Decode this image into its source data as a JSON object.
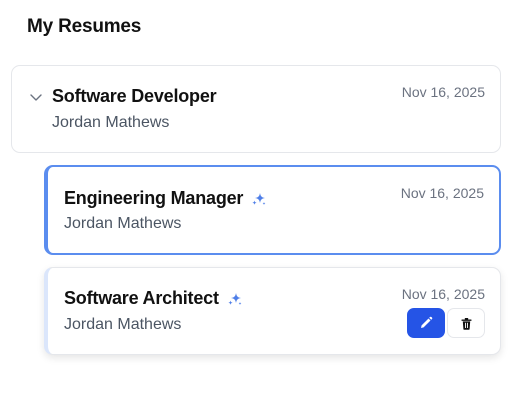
{
  "header": {
    "title": "My Resumes"
  },
  "resumes": [
    {
      "title": "Software Developer",
      "owner": "Jordan Mathews",
      "date": "Nov 16, 2025",
      "expanded": true,
      "ai": false
    },
    {
      "title": "Engineering Manager",
      "owner": "Jordan Mathews",
      "date": "Nov 16, 2025",
      "ai": true,
      "selected": true
    },
    {
      "title": "Software Architect",
      "owner": "Jordan Mathews",
      "date": "Nov 16, 2025",
      "ai": true,
      "hovered": true
    }
  ],
  "icons": {
    "chevron": "chevron-down-icon",
    "ai": "sparkles-icon",
    "edit": "pencil-icon",
    "delete": "trash-icon"
  },
  "colors": {
    "accent": "#2554e6",
    "selected_border": "#5b8def",
    "sparkle": "#4f7fe8"
  }
}
